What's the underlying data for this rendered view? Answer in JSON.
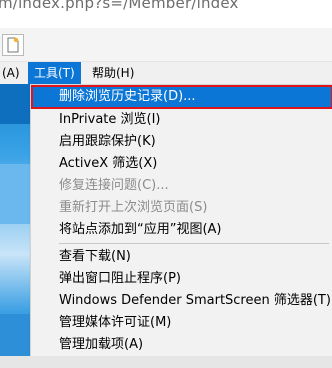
{
  "address_bar": {
    "url_text": "m/index.php?s=/Member/index"
  },
  "menubar": {
    "partial_label": "(A)",
    "tools_label": "工具(T)",
    "help_label": "帮助(H)"
  },
  "tools_menu": {
    "items": [
      {
        "label": "删除浏览历史记录(D)...",
        "state": "selected"
      },
      {
        "label": "InPrivate 浏览(I)",
        "state": "normal"
      },
      {
        "label": "启用跟踪保护(K)",
        "state": "normal"
      },
      {
        "label": "ActiveX 筛选(X)",
        "state": "normal"
      },
      {
        "label": "修复连接问题(C)...",
        "state": "disabled"
      },
      {
        "label": "重新打开上次浏览页面(S)",
        "state": "disabled"
      },
      {
        "label": "将站点添加到“应用”视图(A)",
        "state": "normal"
      },
      {
        "label": "查看下载(N)",
        "state": "normal"
      },
      {
        "label": "弹出窗口阻止程序(P)",
        "state": "normal"
      },
      {
        "label": "Windows Defender SmartScreen 筛选器(T)",
        "state": "normal"
      },
      {
        "label": "管理媒体许可证(M)",
        "state": "normal"
      },
      {
        "label": "管理加载项(A)",
        "state": "normal"
      }
    ]
  },
  "colors": {
    "highlight": "#0b76d6",
    "callout_border": "#e0141b",
    "menu_bg": "#f2f2f2"
  }
}
